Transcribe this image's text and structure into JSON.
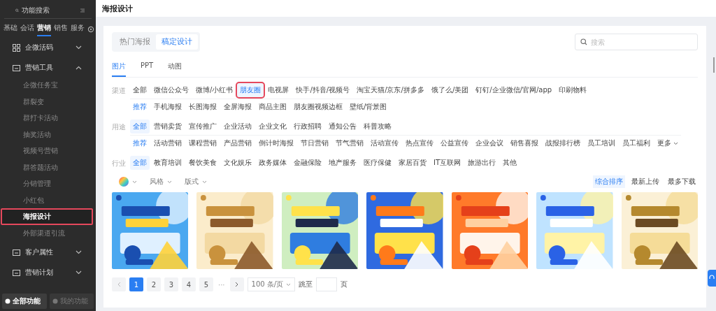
{
  "sidebar": {
    "search": {
      "placeholder": "功能搜索"
    },
    "tabs": [
      {
        "label": "基础",
        "selected": false
      },
      {
        "label": "会话",
        "selected": false
      },
      {
        "label": "营销",
        "selected": true
      },
      {
        "label": "销售",
        "selected": false
      },
      {
        "label": "服务",
        "selected": false
      }
    ],
    "groups": [
      {
        "label": "企微活码",
        "expanded": false
      },
      {
        "label": "营销工具",
        "expanded": true,
        "children": [
          {
            "label": "企微任务宝",
            "selected": false,
            "highlighted": false
          },
          {
            "label": "群裂变",
            "selected": false,
            "highlighted": false
          },
          {
            "label": "群打卡活动",
            "selected": false,
            "highlighted": false
          },
          {
            "label": "抽奖活动",
            "selected": false,
            "highlighted": false
          },
          {
            "label": "视频号营销",
            "selected": false,
            "highlighted": false
          },
          {
            "label": "群答题活动",
            "selected": false,
            "highlighted": false
          },
          {
            "label": "分销管理",
            "selected": false,
            "highlighted": false
          },
          {
            "label": "小红包",
            "selected": false,
            "highlighted": false
          },
          {
            "label": "海报设计",
            "selected": true,
            "highlighted": true
          },
          {
            "label": "外部渠道引流",
            "selected": false,
            "highlighted": false
          }
        ]
      },
      {
        "label": "客户属性",
        "expanded": false
      },
      {
        "label": "营销计划",
        "expanded": false
      }
    ],
    "footer": [
      {
        "label": "全部功能",
        "selected": true
      },
      {
        "label": "我的功能",
        "selected": false
      }
    ]
  },
  "page_title": "海报设计",
  "source_tabs": [
    {
      "label": "热门海报",
      "selected": false
    },
    {
      "label": "稿定设计",
      "selected": true
    }
  ],
  "search": {
    "placeholder": "搜索"
  },
  "type_tabs": [
    {
      "label": "图片",
      "selected": true
    },
    {
      "label": "PPT",
      "selected": false
    },
    {
      "label": "动图",
      "selected": false
    }
  ],
  "filters": [
    {
      "label": "渠道",
      "rows": [
        {
          "options": [
            {
              "text": "全部",
              "selected": false,
              "highlighted": false
            },
            {
              "text": "微信公众号",
              "selected": false,
              "highlighted": false
            },
            {
              "text": "微博/小红书",
              "selected": false,
              "highlighted": false
            },
            {
              "text": "朋友圈",
              "selected": true,
              "highlighted": true
            },
            {
              "text": "电视屏",
              "selected": false,
              "highlighted": false
            },
            {
              "text": "快手/抖音/视频号",
              "selected": false,
              "highlighted": false
            },
            {
              "text": "淘宝天猫/京东/拼多多",
              "selected": false,
              "highlighted": false
            },
            {
              "text": "饿了么/美团",
              "selected": false,
              "highlighted": false
            },
            {
              "text": "钉钉/企业微信/官网/app",
              "selected": false,
              "highlighted": false
            },
            {
              "text": "印刷物料",
              "selected": false,
              "highlighted": false
            }
          ]
        },
        {
          "options": [
            {
              "text": "推荐",
              "selected": true,
              "highlighted": false
            },
            {
              "text": "手机海报",
              "selected": false,
              "highlighted": false
            },
            {
              "text": "长图海报",
              "selected": false,
              "highlighted": false
            },
            {
              "text": "全屏海报",
              "selected": false,
              "highlighted": false
            },
            {
              "text": "商品主图",
              "selected": false,
              "highlighted": false
            },
            {
              "text": "朋友圈视频边框",
              "selected": false,
              "highlighted": false
            },
            {
              "text": "壁纸/背景图",
              "selected": false,
              "highlighted": false
            }
          ]
        }
      ]
    },
    {
      "label": "用途",
      "rows": [
        {
          "options": [
            {
              "text": "全部",
              "selected": true,
              "highlighted": false
            },
            {
              "text": "营销卖货",
              "selected": false,
              "highlighted": false
            },
            {
              "text": "宣传推广",
              "selected": false,
              "highlighted": false
            },
            {
              "text": "企业活动",
              "selected": false,
              "highlighted": false
            },
            {
              "text": "企业文化",
              "selected": false,
              "highlighted": false
            },
            {
              "text": "行政招聘",
              "selected": false,
              "highlighted": false
            },
            {
              "text": "通知公告",
              "selected": false,
              "highlighted": false
            },
            {
              "text": "科普攻略",
              "selected": false,
              "highlighted": false
            }
          ]
        },
        {
          "options": [
            {
              "text": "推荐",
              "selected": true,
              "highlighted": false
            },
            {
              "text": "活动营销",
              "selected": false,
              "highlighted": false
            },
            {
              "text": "课程营销",
              "selected": false,
              "highlighted": false
            },
            {
              "text": "产品营销",
              "selected": false,
              "highlighted": false
            },
            {
              "text": "倒计时海报",
              "selected": false,
              "highlighted": false
            },
            {
              "text": "节日营销",
              "selected": false,
              "highlighted": false
            },
            {
              "text": "节气营销",
              "selected": false,
              "highlighted": false
            },
            {
              "text": "活动宣传",
              "selected": false,
              "highlighted": false
            },
            {
              "text": "热点宣传",
              "selected": false,
              "highlighted": false
            },
            {
              "text": "公益宣传",
              "selected": false,
              "highlighted": false
            },
            {
              "text": "企业会议",
              "selected": false,
              "highlighted": false
            },
            {
              "text": "销售喜报",
              "selected": false,
              "highlighted": false
            },
            {
              "text": "战报排行榜",
              "selected": false,
              "highlighted": false
            },
            {
              "text": "员工培训",
              "selected": false,
              "highlighted": false
            },
            {
              "text": "员工福利",
              "selected": false,
              "highlighted": false
            }
          ],
          "more": "更多"
        }
      ]
    },
    {
      "label": "行业",
      "rows": [
        {
          "options": [
            {
              "text": "全部",
              "selected": true,
              "highlighted": false
            },
            {
              "text": "教育培训",
              "selected": false,
              "highlighted": false
            },
            {
              "text": "餐饮美食",
              "selected": false,
              "highlighted": false
            },
            {
              "text": "文化娱乐",
              "selected": false,
              "highlighted": false
            },
            {
              "text": "政务媒体",
              "selected": false,
              "highlighted": false
            },
            {
              "text": "金融保险",
              "selected": false,
              "highlighted": false
            },
            {
              "text": "地产服务",
              "selected": false,
              "highlighted": false
            },
            {
              "text": "医疗保健",
              "selected": false,
              "highlighted": false
            },
            {
              "text": "家居百货",
              "selected": false,
              "highlighted": false
            },
            {
              "text": "IT互联网",
              "selected": false,
              "highlighted": false
            },
            {
              "text": "旅游出行",
              "selected": false,
              "highlighted": false
            },
            {
              "text": "其他",
              "selected": false,
              "highlighted": false
            }
          ]
        }
      ]
    }
  ],
  "dropdowns": [
    "风格",
    "版式"
  ],
  "sort": [
    {
      "label": "综合排序",
      "selected": true
    },
    {
      "label": "最新上传",
      "selected": false
    },
    {
      "label": "最多下载",
      "selected": false
    }
  ],
  "posters": [
    {
      "kind": "picture"
    },
    {
      "kind": "picture"
    },
    {
      "kind": "picture"
    },
    {
      "kind": "picture"
    },
    {
      "kind": "picture"
    },
    {
      "kind": "picture"
    },
    {
      "kind": "picture"
    }
  ],
  "pagination": {
    "pages": [
      {
        "label": "1",
        "selected": true
      },
      {
        "label": "2",
        "selected": false
      },
      {
        "label": "3",
        "selected": false
      },
      {
        "label": "4",
        "selected": false
      },
      {
        "label": "5",
        "selected": false
      }
    ],
    "ellipsis": "···",
    "page_size": "100 条/页",
    "jump_label": "跳至",
    "page_unit": "页"
  }
}
